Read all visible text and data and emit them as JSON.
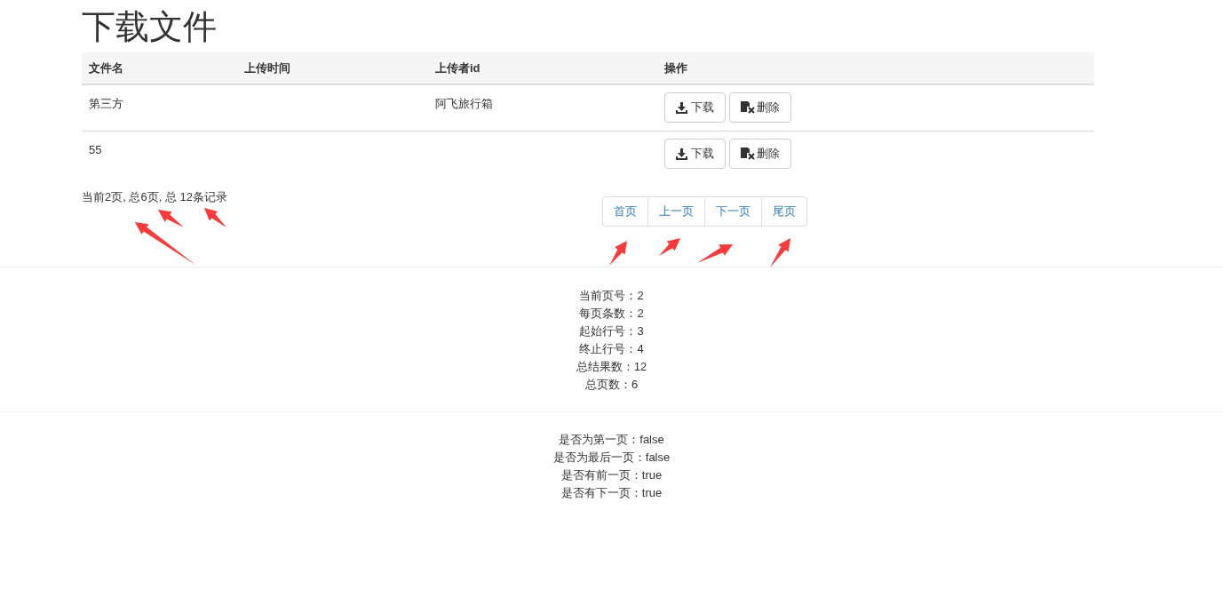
{
  "title": "下载文件",
  "table": {
    "columns": [
      "文件名",
      "上传时间",
      "上传者id",
      "操作"
    ],
    "rows": [
      {
        "cells": [
          "第三方",
          "",
          "阿飞旅行箱"
        ],
        "actions": [
          {
            "kind": "download",
            "label": "下载"
          },
          {
            "kind": "delete",
            "label": "删除"
          }
        ]
      },
      {
        "cells": [
          "55",
          "",
          ""
        ],
        "actions": [
          {
            "kind": "download",
            "label": "下载"
          },
          {
            "kind": "delete",
            "label": "删除"
          }
        ]
      }
    ]
  },
  "page_summary": "当前2页, 总6页, 总 12条记录",
  "pager": [
    "首页",
    "上一页",
    "下一页",
    "尾页"
  ],
  "stats": [
    "当前页号：2",
    "每页条数：2",
    "起始行号：3",
    "终止行号：4",
    "总结果数：12",
    "总页数：6"
  ],
  "flags": [
    "是否为第一页：false",
    "是否为最后一页：false",
    "是否有前一页：true",
    "是否有下一页：true"
  ]
}
